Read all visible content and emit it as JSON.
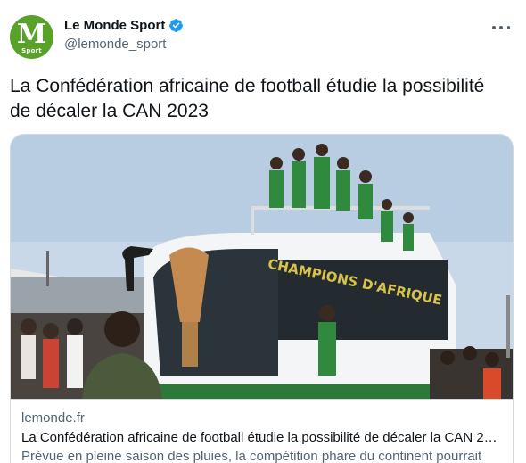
{
  "author": {
    "display_name": "Le Monde Sport",
    "handle": "@lemonde_sport",
    "avatar_letter": "M",
    "avatar_caption": "Sport",
    "avatar_color": "#59a22a",
    "verified": true,
    "verified_icon": "verified-badge-icon"
  },
  "tweet": {
    "text": "La Confédération africaine de football étudie la possibilité de décaler la CAN 2023"
  },
  "card": {
    "image_icon": "bus-celebration-photo",
    "bus_banner_text": "CHAMPIONS D'AFRIQUE",
    "domain": "lemonde.fr",
    "title": "La Confédération africaine de football étudie la possibilité de décaler la CAN 2…",
    "description": "Prévue en pleine saison des pluies, la compétition phare du continent pourrait"
  },
  "colors": {
    "text_primary": "#0f1419",
    "text_secondary": "#536471",
    "border": "#cfd9de",
    "verified_blue": "#1d9bf0"
  }
}
